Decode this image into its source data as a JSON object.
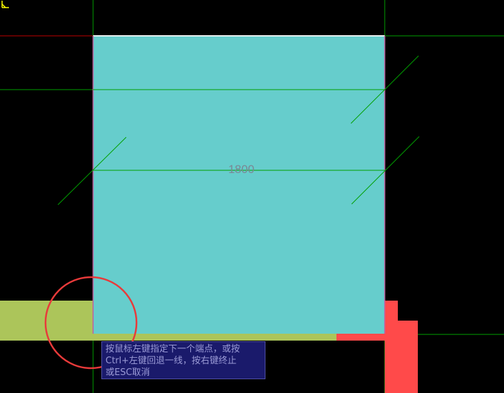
{
  "drawing": {
    "slab_dimension": "1800"
  },
  "prompt": {
    "line1": "按鼠标左键指定下一个端点，或按",
    "line2": "Ctrl+左键回退一线，按右键终止",
    "line3": "或ESC取消"
  },
  "colors": {
    "background": "#000000",
    "slab_fill": "#66cdcc",
    "grid_line": "#00a000",
    "axis_red": "#c00000",
    "wall_left": "#acc55a",
    "column_right": "#ff4a4a",
    "highlight_circle": "#e83a3a",
    "cursor": "#ffff00",
    "tooltip_bg": "#1a1a6b",
    "tooltip_text": "#9a9ad6"
  },
  "icons": {
    "cursor": "crosshair-cursor-icon",
    "highlight": "highlight-circle-icon"
  }
}
